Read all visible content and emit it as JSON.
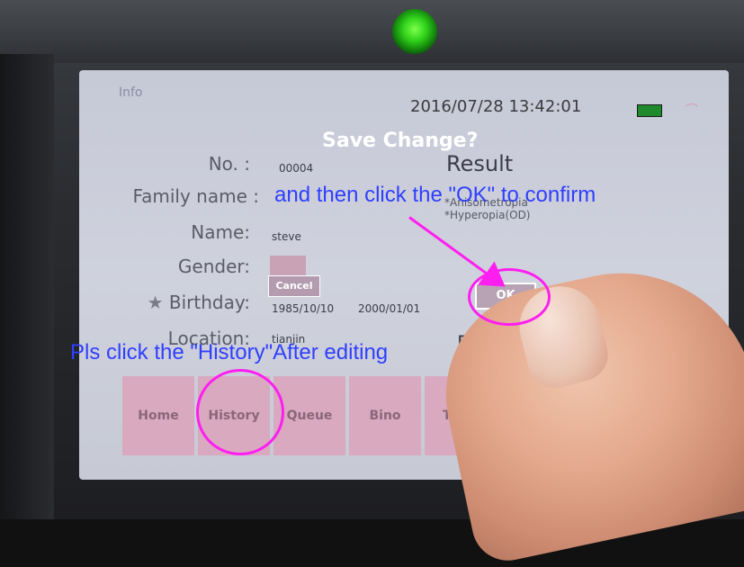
{
  "status": {
    "title": "Info",
    "datetime": "2016/07/28 13:42:01"
  },
  "dialog": {
    "title": "Save Change?",
    "cancel_label": "Cancel",
    "ok_label": "OK"
  },
  "form": {
    "no_label": "No. :",
    "no_value": "00004",
    "family_label": "Family name :",
    "name_label": "Name:",
    "name_value": "steve",
    "gender_label": "Gender:",
    "birthday_label": "Birthday:",
    "birthday_value": "1985/10/10",
    "birthday_value2": "2000/01/01",
    "location_label": "Location:",
    "location_value": "tianjin"
  },
  "result": {
    "header": "Result",
    "line1": "*Anisometropia",
    "line2": "*Hyperopia(OD)",
    "date_label": "Da"
  },
  "nav": {
    "home": "Home",
    "history": "History",
    "queue": "Queue",
    "bino": "Bino",
    "tools": "Tools"
  },
  "annotations": {
    "confirm": "and then click the \"OK\" to confirm",
    "history": "Pls click the \"History\"After editing"
  },
  "colors": {
    "annotation_text": "#2f3fff",
    "annotation_mark": "#ff1ef0",
    "nav_button": "#d9a9c0"
  }
}
